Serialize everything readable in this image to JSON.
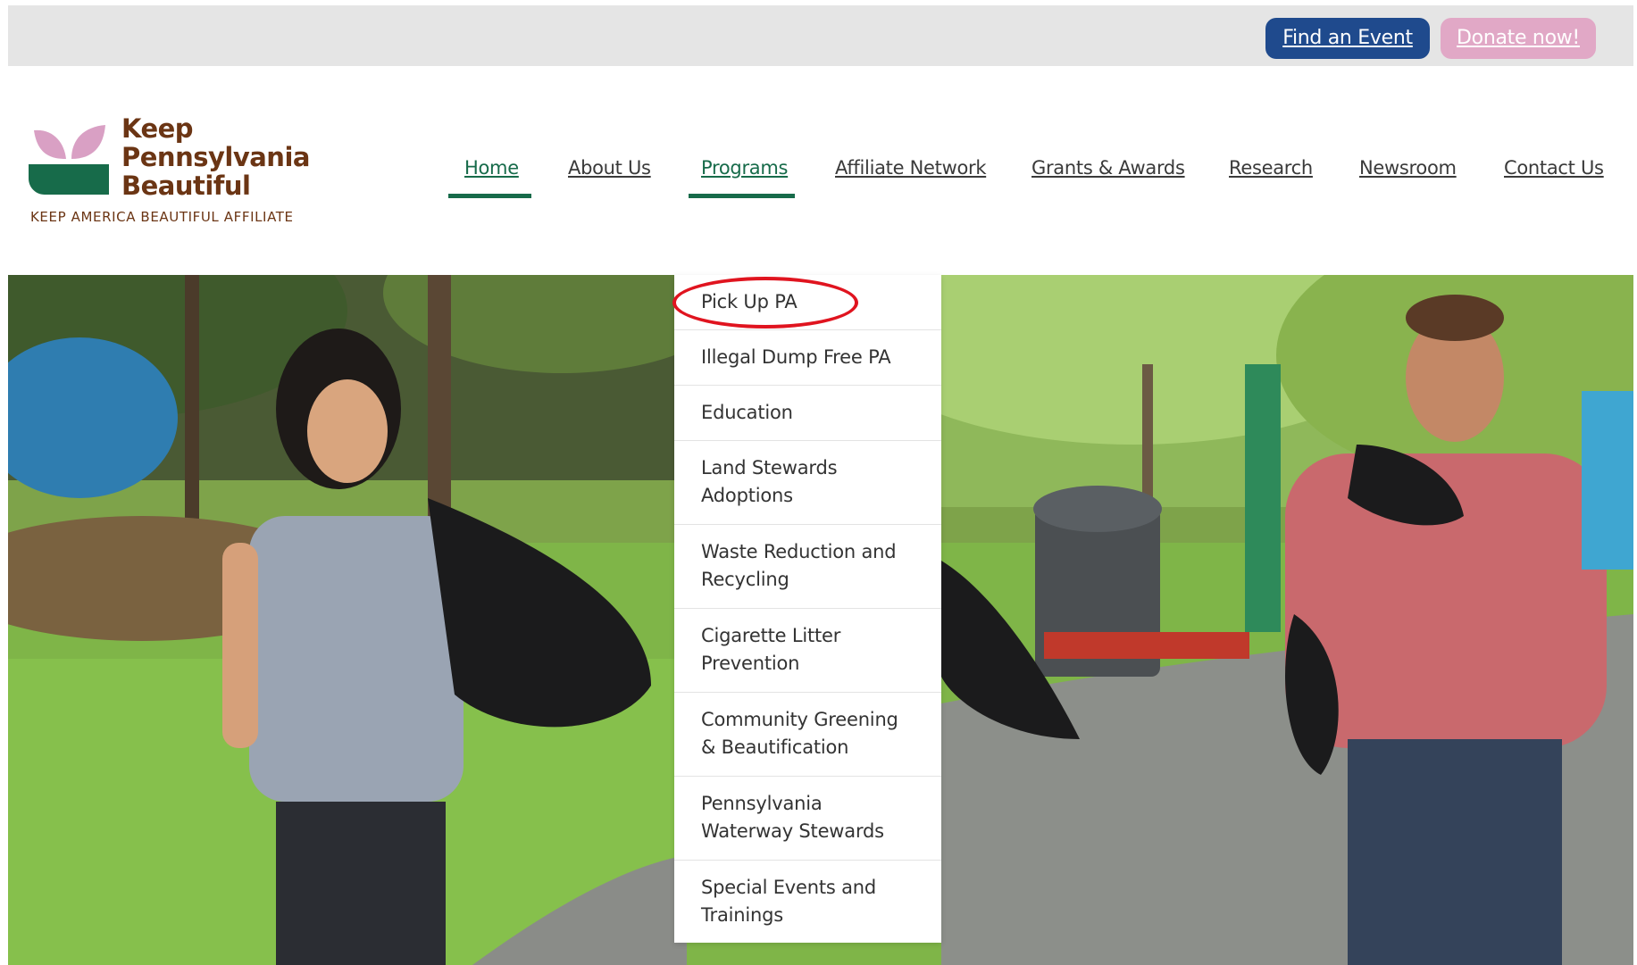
{
  "topbar": {
    "find_event_label": "Find an Event",
    "donate_label": "Donate now!"
  },
  "logo": {
    "line1": "Keep",
    "line2": "Pennsylvania",
    "line3": "Beautiful",
    "affiliate": "KEEP AMERICA BEAUTIFUL AFFILIATE"
  },
  "nav": {
    "items": [
      {
        "label": "Home",
        "active": true
      },
      {
        "label": "About Us",
        "active": false
      },
      {
        "label": "Programs",
        "active": true
      },
      {
        "label": "Affiliate Network",
        "active": false
      },
      {
        "label": "Grants & Awards",
        "active": false
      },
      {
        "label": "Research",
        "active": false
      },
      {
        "label": "Newsroom",
        "active": false
      },
      {
        "label": "Contact Us",
        "active": false
      }
    ]
  },
  "dropdown": {
    "items": [
      {
        "line1": "Pick Up PA",
        "line2": "",
        "highlighted": true
      },
      {
        "line1": "Illegal Dump Free PA",
        "line2": ""
      },
      {
        "line1": "Education",
        "line2": ""
      },
      {
        "line1": "Land Stewards",
        "line2": "Adoptions"
      },
      {
        "line1": "Waste Reduction and",
        "line2": "Recycling"
      },
      {
        "line1": "Cigarette Litter",
        "line2": "Prevention"
      },
      {
        "line1": "Community Greening",
        "line2": "& Beautification"
      },
      {
        "line1": "Pennsylvania",
        "line2": "Waterway Stewards"
      },
      {
        "line1": "Special Events and",
        "line2": "Trainings"
      }
    ]
  },
  "colors": {
    "brand_green": "#176b4a",
    "brand_brown": "#6b3514",
    "brand_pink": "#d9a0c4",
    "find_button": "#1f4a8d",
    "donate_button": "#e1a8c6",
    "highlight_red": "#e0141f"
  }
}
